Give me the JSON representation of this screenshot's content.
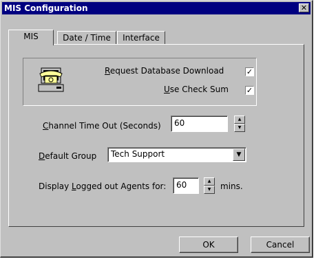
{
  "window": {
    "title": "MIS Configuration",
    "close_glyph": "✕",
    "close_icon": "close-icon"
  },
  "tabs": [
    {
      "label": "MIS",
      "active": true
    },
    {
      "label": "Date / Time",
      "active": false
    },
    {
      "label": "Interface",
      "active": false
    }
  ],
  "database": {
    "icon": "telephone-computer-icon",
    "request_download_pre": "",
    "request_download_accel": "R",
    "request_download_post": "equest Database Download",
    "request_download_checked": true,
    "checksum_pre": "",
    "checksum_accel": "U",
    "checksum_post": "se Check Sum",
    "checksum_checked": true,
    "check_glyph": "✓"
  },
  "channel_timeout": {
    "label_accel": "C",
    "label_post": "hannel Time Out (Seconds)",
    "value": "60"
  },
  "default_group": {
    "label_accel": "D",
    "label_post": "efault Group",
    "value": "Tech Support"
  },
  "logged_out": {
    "label_pre": "Display ",
    "label_accel": "L",
    "label_post": "ogged out Agents for:",
    "value": "60",
    "unit": "mins."
  },
  "spinner": {
    "up_glyph": "▲",
    "down_glyph": "▼"
  },
  "dropdown_glyph": "▼",
  "buttons": {
    "ok": "OK",
    "cancel": "Cancel"
  }
}
